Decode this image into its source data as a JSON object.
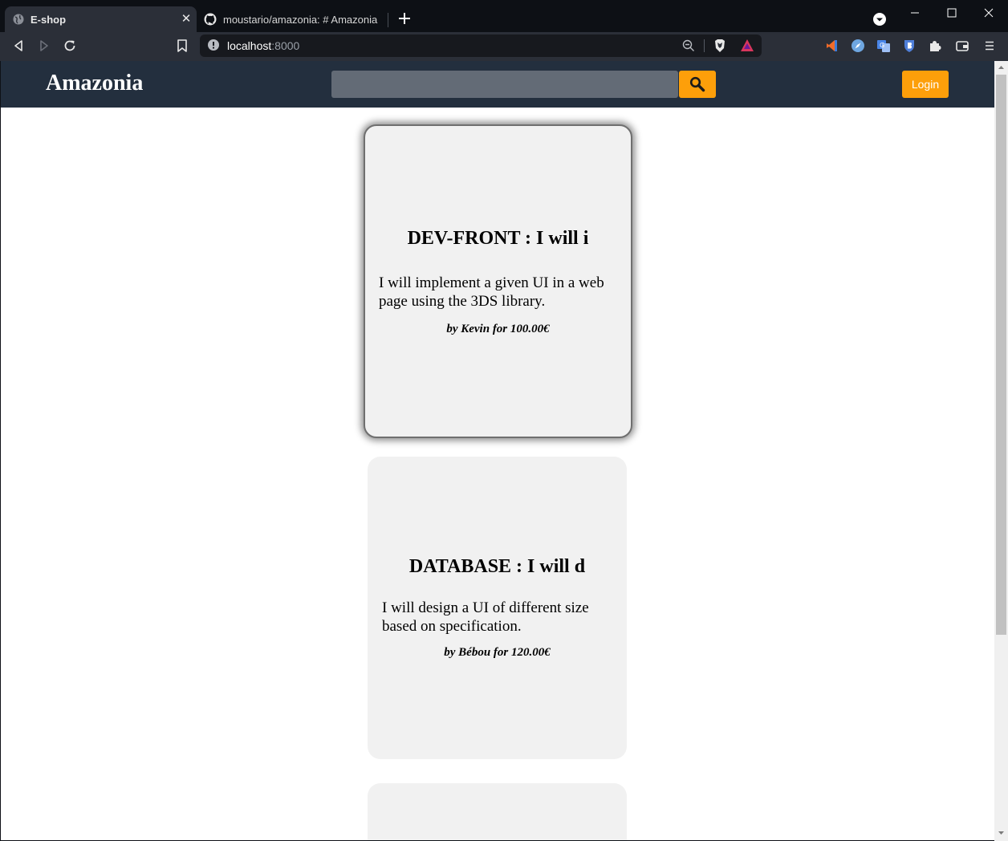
{
  "browser": {
    "tabs": [
      {
        "title": "E-shop",
        "active": true
      },
      {
        "title": "moustario/amazonia: # Amazonia",
        "active": false
      }
    ],
    "address": {
      "host": "localhost",
      "port": ":8000"
    }
  },
  "header": {
    "brand": "Amazonia",
    "search_placeholder": "",
    "login_label": "Login",
    "accent_color": "#fd9f0a",
    "nav_color": "#232f3e"
  },
  "cards": [
    {
      "title": "DEV-FRONT : I will i",
      "description": "I will implement a given UI in a web page using the 3DS library.",
      "meta": "by Kevin for 100.00€"
    },
    {
      "title": "DATABASE : I will d",
      "description": "I will design a UI of different size based on specification.",
      "meta": "by Bébou for 120.00€"
    }
  ]
}
